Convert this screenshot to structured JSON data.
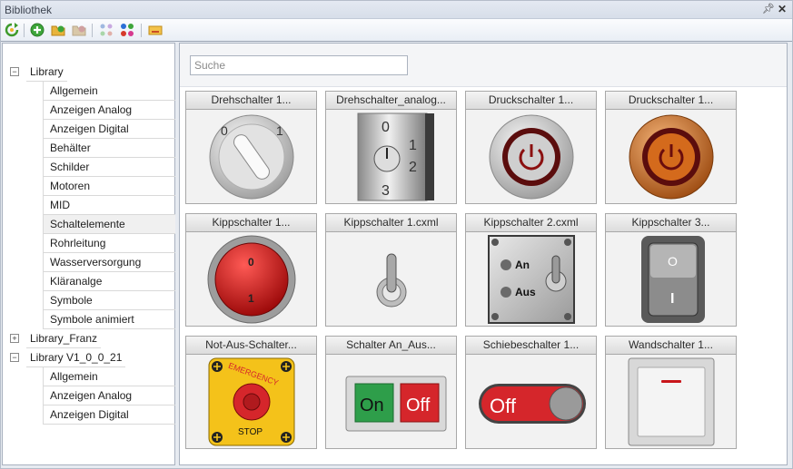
{
  "window": {
    "title": "Bibliothek",
    "pin_icon": "pin-icon",
    "close_icon": "close-icon"
  },
  "toolbar": {
    "buttons": [
      {
        "name": "refresh-icon"
      },
      {
        "name": "add-icon"
      },
      {
        "name": "open-folder-icon"
      },
      {
        "name": "folder-disabled-icon"
      },
      {
        "name": "group-icon"
      },
      {
        "name": "colors-icon"
      },
      {
        "name": "rename-icon"
      }
    ]
  },
  "tree": {
    "roots": [
      {
        "label": "Library",
        "expanded": true,
        "children": [
          "Allgemein",
          "Anzeigen Analog",
          "Anzeigen Digital",
          "Behälter",
          "Schilder",
          "Motoren",
          "MID",
          "Schaltelemente",
          "Rohrleitung",
          "Wasserversorgung",
          "Kläranalge",
          "Symbole",
          "Symbole animiert"
        ]
      },
      {
        "label": "Library_Franz",
        "expanded": false,
        "children": []
      },
      {
        "label": "Library V1_0_0_21",
        "expanded": true,
        "children": [
          "Allgemein",
          "Anzeigen Analog",
          "Anzeigen Digital"
        ]
      }
    ],
    "selected": "Schaltelemente"
  },
  "search": {
    "placeholder": "Suche",
    "value": ""
  },
  "items": [
    {
      "title": "Drehschalter 1...",
      "kind": "rotary-key",
      "labels": [
        "0",
        "1"
      ]
    },
    {
      "title": "Drehschalter_analog...",
      "kind": "rotary-analog",
      "labels": [
        "0",
        "1",
        "2",
        "3"
      ]
    },
    {
      "title": "Druckschalter 1...",
      "kind": "push-gray"
    },
    {
      "title": "Druckschalter 1...",
      "kind": "push-orange"
    },
    {
      "title": "Kippschalter 1...",
      "kind": "red-button",
      "labels": [
        "0",
        "1"
      ]
    },
    {
      "title": "Kippschalter 1.cxml",
      "kind": "toggle-lever"
    },
    {
      "title": "Kippschalter 2.cxml",
      "kind": "toggle-panel",
      "labels": [
        "An",
        "Aus"
      ]
    },
    {
      "title": "Kippschalter 3...",
      "kind": "rocker",
      "labels": [
        "O",
        "I"
      ]
    },
    {
      "title": "Not-Aus-Schalter...",
      "kind": "emergency-stop",
      "labels": [
        "EMERGENCY",
        "STOP"
      ]
    },
    {
      "title": "Schalter An_Aus...",
      "kind": "on-off",
      "labels": [
        "On",
        "Off"
      ]
    },
    {
      "title": "Schiebeschalter 1...",
      "kind": "slide-switch",
      "labels": [
        "Off"
      ]
    },
    {
      "title": "Wandschalter 1...",
      "kind": "wall-switch"
    }
  ],
  "colors": {
    "accent_red": "#c8161b",
    "accent_orange": "#d46a1c",
    "on_green": "#2e9e4a",
    "off_red": "#d5262b",
    "estop_yellow": "#f4c21a"
  }
}
